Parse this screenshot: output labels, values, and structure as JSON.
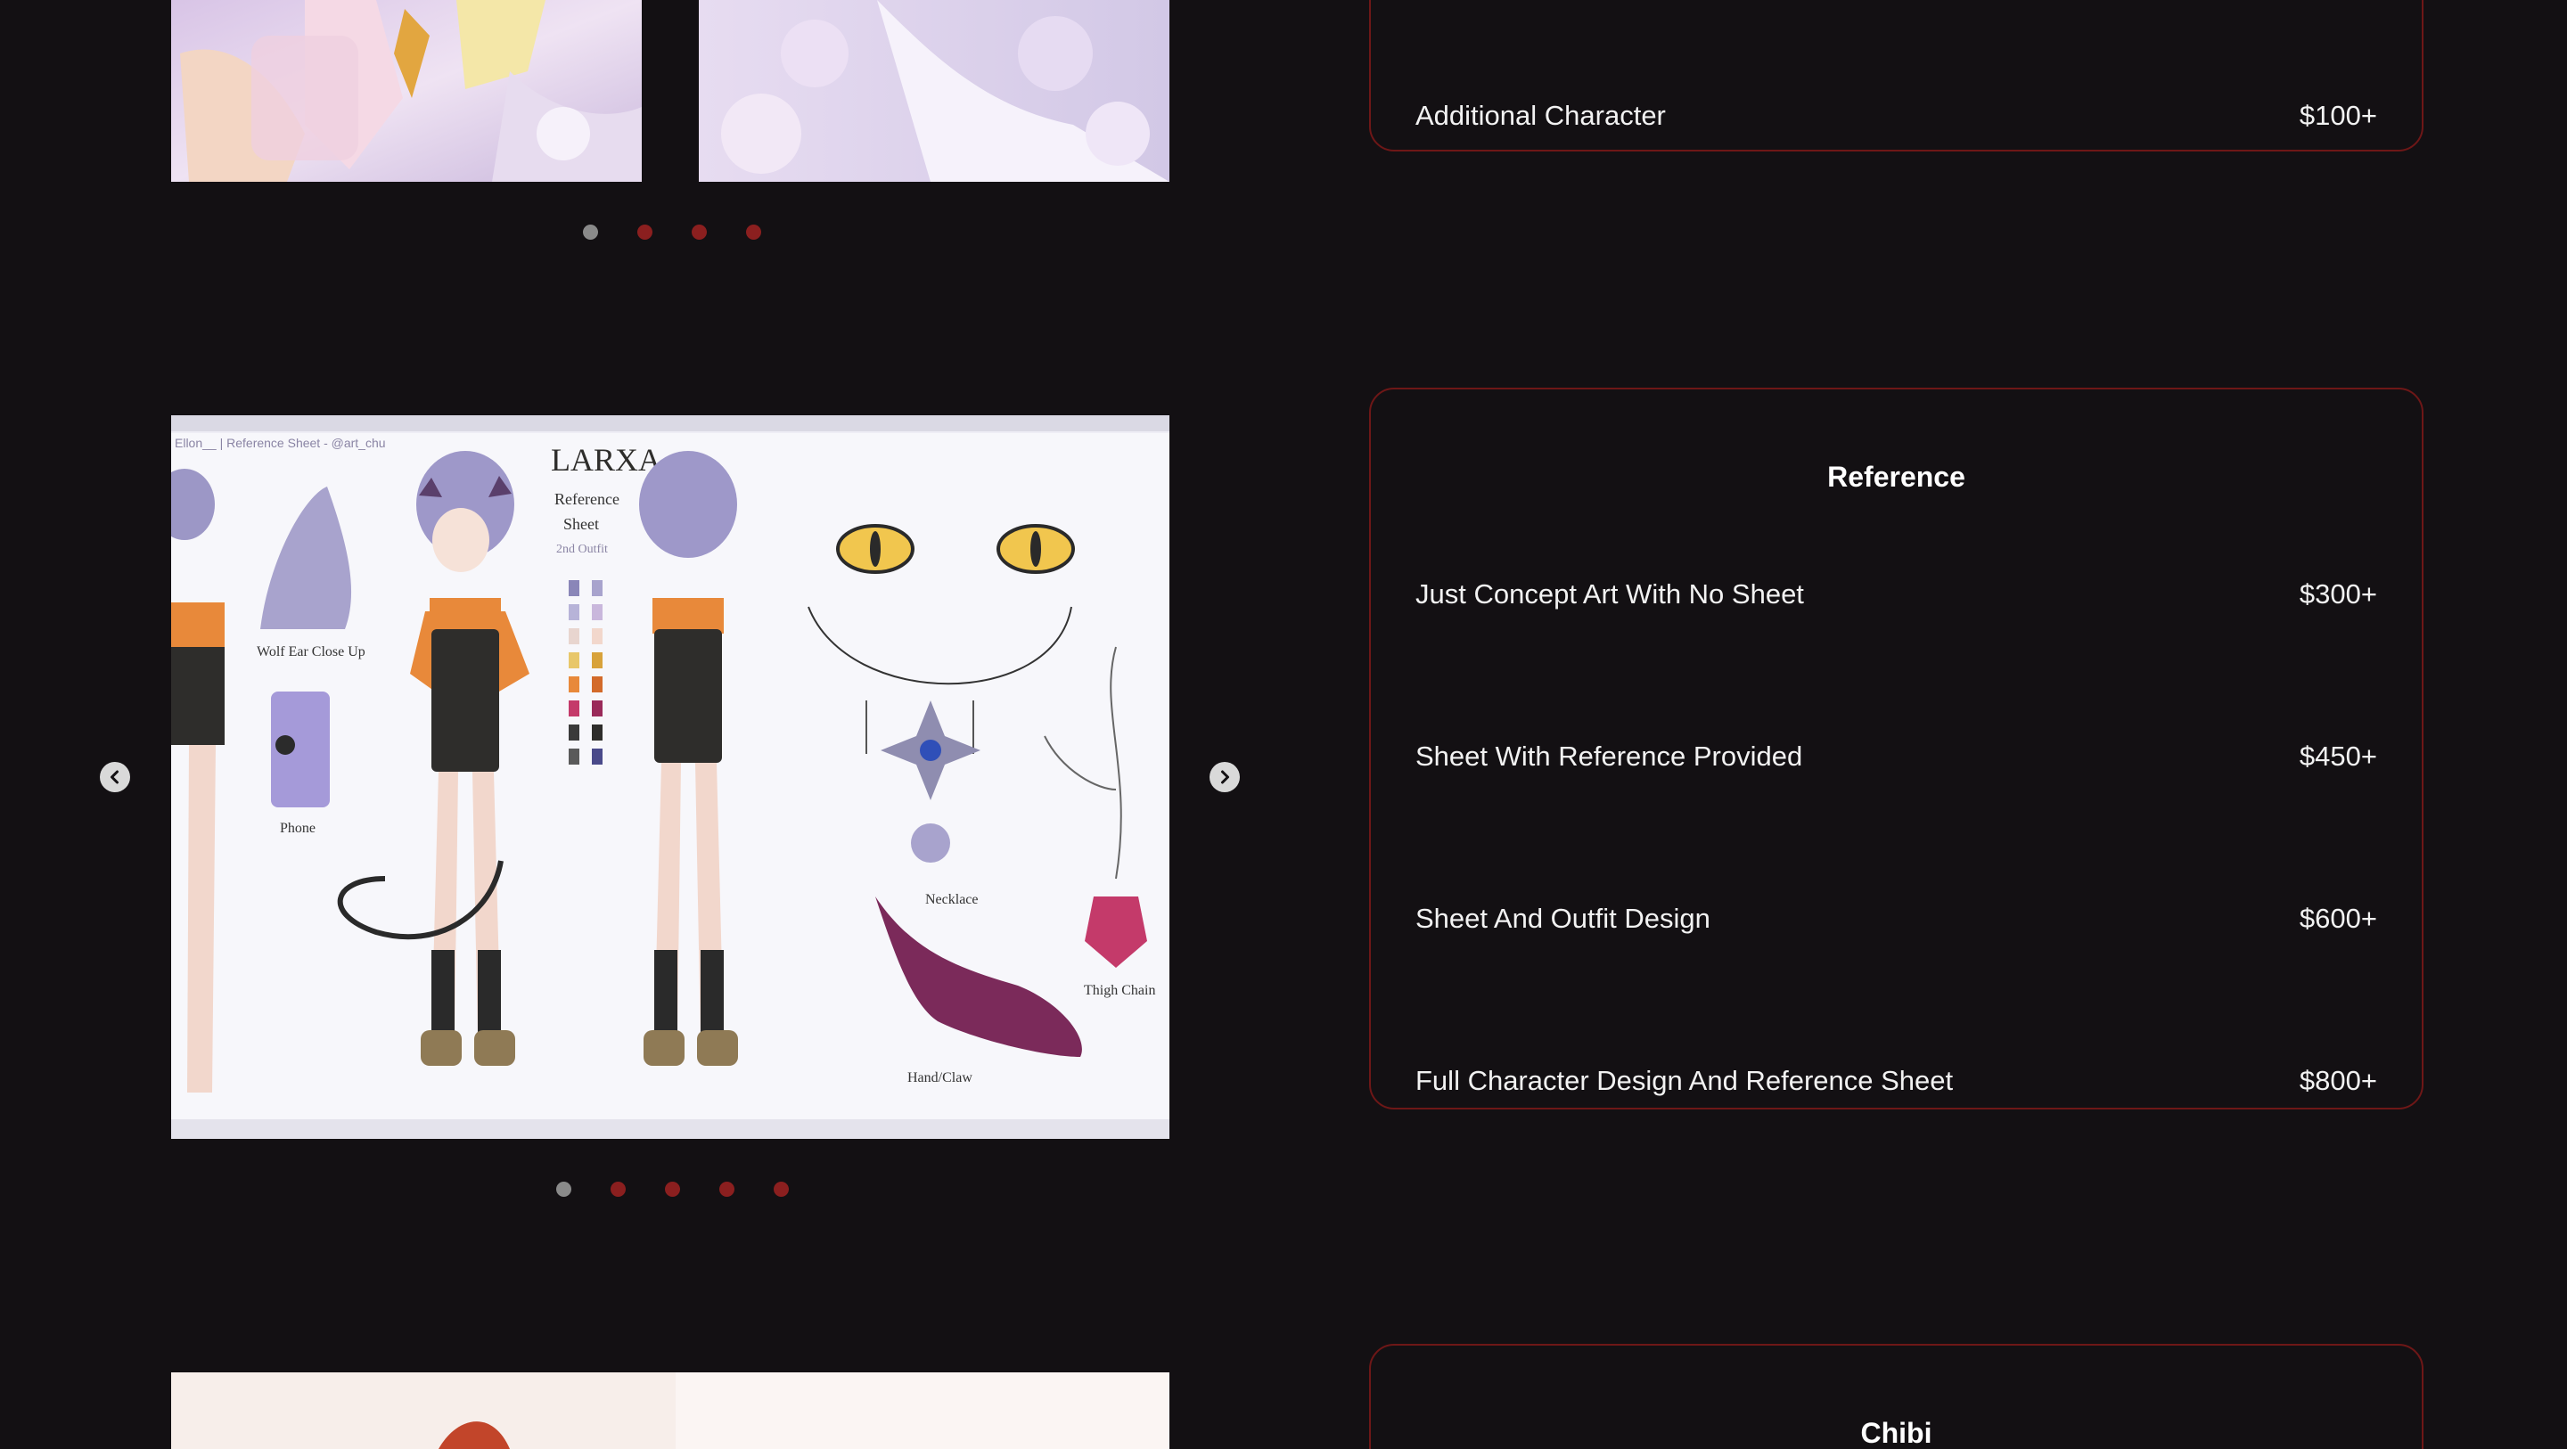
{
  "top_section": {
    "card": {
      "rows": [
        {
          "label": "Additional Character",
          "price": "$100+"
        }
      ]
    },
    "carousel": {
      "dot_count": 4,
      "active_index": 0
    }
  },
  "reference_section": {
    "card": {
      "title": "Reference",
      "rows": [
        {
          "label": "Just Concept Art With No Sheet",
          "price": "$300+"
        },
        {
          "label": "Sheet With Reference Provided",
          "price": "$450+"
        },
        {
          "label": "Sheet And Outfit Design",
          "price": "$600+"
        },
        {
          "label": "Full Character Design And Reference Sheet",
          "price": "$800+"
        }
      ]
    },
    "carousel": {
      "dot_count": 5,
      "active_index": 0,
      "artwork": {
        "header_text": "Ellon__ | Reference Sheet - @art_chu",
        "name": "LARXA",
        "subtitle_1": "Reference",
        "subtitle_2": "Sheet",
        "subtitle_3": "2nd Outfit",
        "label_wolf": "Wolf Ear Close Up",
        "label_phone": "Phone",
        "label_necklace": "Necklace",
        "label_thigh": "Thigh Chain",
        "label_hand": "Hand/Claw"
      }
    }
  },
  "chibi_section": {
    "card": {
      "title": "Chibi"
    }
  },
  "icons": {
    "prev": "chevron-left-icon",
    "next": "chevron-right-icon"
  },
  "colors": {
    "background": "#131013",
    "card_border": "#6e1717",
    "dot_inactive": "#8b1f1f",
    "dot_active": "#8a8a8a"
  }
}
